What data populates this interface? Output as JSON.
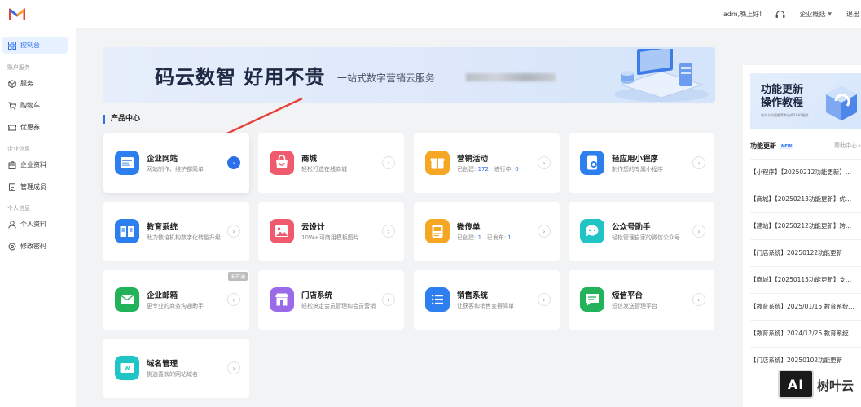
{
  "topbar": {
    "greeting": "adm,晚上好!",
    "overview": "企业概括",
    "logout": "退出"
  },
  "sidebar": {
    "dashboard": "控制台",
    "group1": "账户服务",
    "items1": [
      "服务",
      "购物车",
      "优惠券"
    ],
    "group2": "企业信息",
    "items2": [
      "企业资料",
      "管理成员"
    ],
    "group3": "个人信息",
    "items3": [
      "个人资料",
      "修改密码"
    ]
  },
  "banner": {
    "title": "码云数智  好用不贵",
    "subtitle": "一站式数字营销云服务"
  },
  "section_title": "产品中心",
  "cards": [
    {
      "name": "企业网站",
      "desc": "网站制作、维护都简单"
    },
    {
      "name": "商城",
      "desc": "轻松打造在线商城"
    },
    {
      "name": "营销活动",
      "desc_a": "已创建:",
      "num1": "172",
      "desc_b": "进行中:",
      "num2": "0"
    },
    {
      "name": "轻应用小程序",
      "desc": "制作您的专属小程序"
    },
    {
      "name": "教育系统",
      "desc": "助力教培机构数字化转型升级"
    },
    {
      "name": "云设计",
      "desc": "10W+可商用模板图片"
    },
    {
      "name": "微传单",
      "desc_a": "已创建:",
      "num1": "1",
      "desc_b": "已发布:",
      "num2": "1"
    },
    {
      "name": "公众号助手",
      "desc": "轻松管理自家的微信公众号"
    },
    {
      "name": "企业邮箱",
      "desc": "更专业的商务沟通助手",
      "badge": "未开通"
    },
    {
      "name": "门店系统",
      "desc": "轻松搞定会员管理和会员营销"
    },
    {
      "name": "销售系统",
      "desc": "让获客和销售变得简单"
    },
    {
      "name": "短信平台",
      "desc": "短信发送管理平台"
    },
    {
      "name": "域名管理",
      "desc": "挑选喜欢的网站域名"
    }
  ],
  "right_panel": {
    "banner_line1": "功能更新",
    "banner_line2": "操作教程",
    "banner_note": "助力卡为您推荐专业的SAAS服务",
    "header": "功能更新",
    "new_tag": "NEW",
    "help_center": "帮助中心 ›",
    "updates": [
      "【小程序】【20250212功能更新】...",
      "【商城】【20250213功能更新】优...",
      "【建站】【20250212功能更新】跨...",
      "【门店系统】20250122功能更新",
      "【商城】【20250115功能更新】支...",
      "【教育系统】2025/01/15 教育系统...",
      "【教育系统】2024/12/25 教育系统...",
      "【门店系统】20250102功能更新"
    ]
  },
  "watermark": {
    "box": "AI",
    "text": "树叶云"
  },
  "colors": {
    "accent": "#2d6fe8",
    "arrow": "#e8413a"
  }
}
